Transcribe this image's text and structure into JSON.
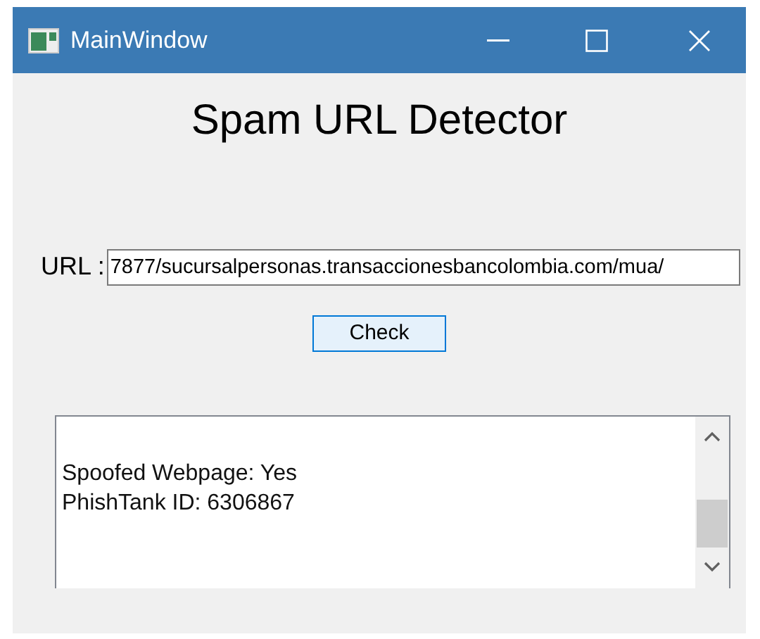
{
  "window": {
    "title": "MainWindow"
  },
  "heading": "Spam URL Detector",
  "url": {
    "label": "URL :",
    "value": "7877/sucursalpersonas.transaccionesbancolombia.com/mua/"
  },
  "check_button": "Check",
  "output": {
    "lines": [
      "Spoofed Webpage: Yes",
      "PhishTank ID: 6306867"
    ]
  }
}
